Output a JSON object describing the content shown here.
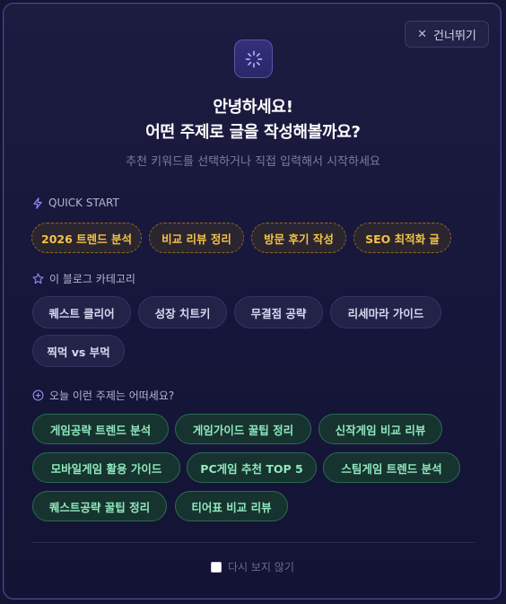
{
  "skip_button": {
    "icon": "close-icon",
    "label": "건너뛰기"
  },
  "logo_icon": "sparkle-loading-icon",
  "title": {
    "line1": "안녕하세요!",
    "line2": "어떤 주제로 글을 작성해볼까요?"
  },
  "subtitle": "추천 키워드를 선택하거나 직접 입력해서 시작하세요",
  "quick_start": {
    "icon": "lightning-icon",
    "label": "QUICK START",
    "items": [
      "2026 트렌드 분석",
      "비교 리뷰 정리",
      "방문 후기 작성",
      "SEO 최적화 글"
    ]
  },
  "categories": {
    "icon": "star-icon",
    "label": "이 블로그 카테고리",
    "items": [
      "퀘스트 클리어",
      "성장 치트키",
      "무결점 공략",
      "리세마라 가이드",
      "찍먹 vs 부먹"
    ]
  },
  "topics": {
    "icon": "plus-circle-icon",
    "label": "오늘 이런 주제는 어떠세요?",
    "items": [
      "게임공략 트렌드 분석",
      "게임가이드 꿀팁 정리",
      "신작게임 비교 리뷰",
      "모바일게임 활용 가이드",
      "PC게임 추천 TOP 5",
      "스팀게임 트렌드 분석",
      "퀘스트공략 꿀팁 정리",
      "티어표 비교 리뷰"
    ]
  },
  "dont_show_again": {
    "label": "다시 보지 않기",
    "checked": false
  },
  "colors": {
    "accent_gold": "#f2c245",
    "accent_green": "#8fe8bd",
    "accent_purple": "#8f8cf2",
    "background": "#141433"
  }
}
